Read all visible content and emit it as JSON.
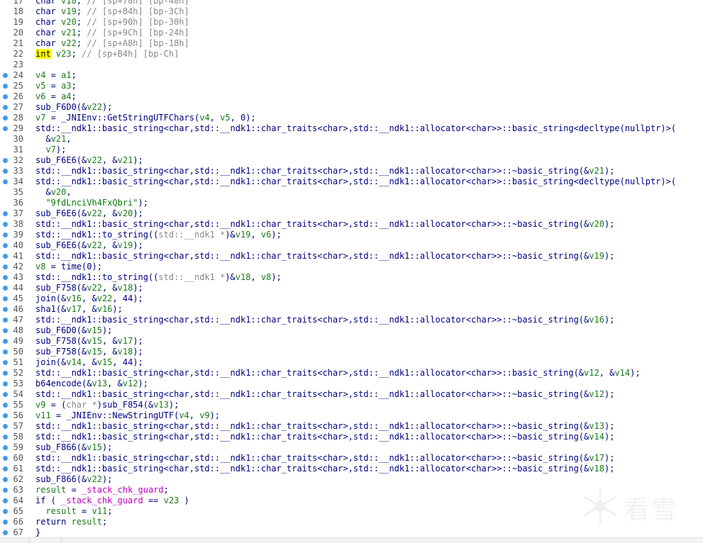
{
  "editor": {
    "lines": [
      {
        "n": "17",
        "bp": false,
        "parts": [
          [
            "t",
            "char "
          ],
          [
            "v",
            "v18"
          ],
          [
            "t",
            "; "
          ],
          [
            "g",
            "// [sp+78h] [bp-48h]"
          ]
        ]
      },
      {
        "n": "18",
        "bp": false,
        "parts": [
          [
            "t",
            "char "
          ],
          [
            "v",
            "v19"
          ],
          [
            "t",
            "; "
          ],
          [
            "g",
            "// [sp+84h] [bp-3Ch]"
          ]
        ]
      },
      {
        "n": "19",
        "bp": false,
        "parts": [
          [
            "t",
            "char "
          ],
          [
            "v",
            "v20"
          ],
          [
            "t",
            "; "
          ],
          [
            "g",
            "// [sp+90h] [bp-30h]"
          ]
        ]
      },
      {
        "n": "20",
        "bp": false,
        "parts": [
          [
            "t",
            "char "
          ],
          [
            "v",
            "v21"
          ],
          [
            "t",
            "; "
          ],
          [
            "g",
            "// [sp+9Ch] [bp-24h]"
          ]
        ]
      },
      {
        "n": "21",
        "bp": false,
        "parts": [
          [
            "t",
            "char "
          ],
          [
            "v",
            "v22"
          ],
          [
            "t",
            "; "
          ],
          [
            "g",
            "// [sp+A8h] [bp-18h]"
          ]
        ]
      },
      {
        "n": "22",
        "bp": false,
        "parts": [
          [
            "h",
            "int"
          ],
          [
            "t",
            " "
          ],
          [
            "v",
            "v23"
          ],
          [
            "t",
            "; "
          ],
          [
            "g",
            "// [sp+B4h] [bp-Ch]"
          ]
        ]
      },
      {
        "n": "23",
        "bp": false,
        "parts": []
      },
      {
        "n": "24",
        "bp": true,
        "parts": [
          [
            "v",
            "v4"
          ],
          [
            "t",
            " = "
          ],
          [
            "v",
            "a1"
          ],
          [
            "t",
            ";"
          ]
        ]
      },
      {
        "n": "25",
        "bp": true,
        "parts": [
          [
            "v",
            "v5"
          ],
          [
            "t",
            " = "
          ],
          [
            "v",
            "a3"
          ],
          [
            "t",
            ";"
          ]
        ]
      },
      {
        "n": "26",
        "bp": true,
        "parts": [
          [
            "v",
            "v6"
          ],
          [
            "t",
            " = "
          ],
          [
            "v",
            "a4"
          ],
          [
            "t",
            ";"
          ]
        ]
      },
      {
        "n": "27",
        "bp": true,
        "parts": [
          [
            "t",
            "sub_F6D0(&"
          ],
          [
            "v",
            "v22"
          ],
          [
            "t",
            ");"
          ]
        ]
      },
      {
        "n": "28",
        "bp": true,
        "parts": [
          [
            "v",
            "v7"
          ],
          [
            "t",
            " = _JNIEnv::GetStringUTFChars("
          ],
          [
            "v",
            "v4"
          ],
          [
            "t",
            ", "
          ],
          [
            "v",
            "v5"
          ],
          [
            "t",
            ", 0);"
          ]
        ]
      },
      {
        "n": "29",
        "bp": true,
        "parts": [
          [
            "t",
            "std::__ndk1::basic_string<char,std::__ndk1::char_traits<char>,std::__ndk1::allocator<char>>::basic_string<decltype(nullptr)>("
          ]
        ]
      },
      {
        "n": "30",
        "bp": false,
        "parts": [
          [
            "t",
            "  &"
          ],
          [
            "v",
            "v21"
          ],
          [
            "t",
            ","
          ]
        ]
      },
      {
        "n": "31",
        "bp": false,
        "parts": [
          [
            "t",
            "  "
          ],
          [
            "v",
            "v7"
          ],
          [
            "t",
            ");"
          ]
        ]
      },
      {
        "n": "32",
        "bp": true,
        "parts": [
          [
            "t",
            "sub_F6E6(&"
          ],
          [
            "v",
            "v22"
          ],
          [
            "t",
            ", &"
          ],
          [
            "v",
            "v21"
          ],
          [
            "t",
            ");"
          ]
        ]
      },
      {
        "n": "33",
        "bp": true,
        "parts": [
          [
            "t",
            "std::__ndk1::basic_string<char,std::__ndk1::char_traits<char>,std::__ndk1::allocator<char>>::~basic_string(&"
          ],
          [
            "v",
            "v21"
          ],
          [
            "t",
            ");"
          ]
        ]
      },
      {
        "n": "34",
        "bp": true,
        "parts": [
          [
            "t",
            "std::__ndk1::basic_string<char,std::__ndk1::char_traits<char>,std::__ndk1::allocator<char>>::basic_string<decltype(nullptr)>("
          ]
        ]
      },
      {
        "n": "35",
        "bp": false,
        "parts": [
          [
            "t",
            "  &"
          ],
          [
            "v",
            "v20"
          ],
          [
            "t",
            ","
          ]
        ]
      },
      {
        "n": "36",
        "bp": false,
        "parts": [
          [
            "t",
            "  "
          ],
          [
            "s",
            "\"9fdLnciVh4FxQbri\""
          ],
          [
            "t",
            ");"
          ]
        ]
      },
      {
        "n": "37",
        "bp": true,
        "parts": [
          [
            "t",
            "sub_F6E6(&"
          ],
          [
            "v",
            "v22"
          ],
          [
            "t",
            ", &"
          ],
          [
            "v",
            "v20"
          ],
          [
            "t",
            ");"
          ]
        ]
      },
      {
        "n": "38",
        "bp": true,
        "parts": [
          [
            "t",
            "std::__ndk1::basic_string<char,std::__ndk1::char_traits<char>,std::__ndk1::allocator<char>>::~basic_string(&"
          ],
          [
            "v",
            "v20"
          ],
          [
            "t",
            ");"
          ]
        ]
      },
      {
        "n": "39",
        "bp": true,
        "parts": [
          [
            "t",
            "std::__ndk1::to_string(("
          ],
          [
            "g",
            "std::__ndk1 *"
          ],
          [
            "t",
            ")&"
          ],
          [
            "v",
            "v19"
          ],
          [
            "t",
            ", "
          ],
          [
            "v",
            "v6"
          ],
          [
            "t",
            ");"
          ]
        ]
      },
      {
        "n": "40",
        "bp": true,
        "parts": [
          [
            "t",
            "sub_F6E6(&"
          ],
          [
            "v",
            "v22"
          ],
          [
            "t",
            ", &"
          ],
          [
            "v",
            "v19"
          ],
          [
            "t",
            ");"
          ]
        ]
      },
      {
        "n": "41",
        "bp": true,
        "parts": [
          [
            "t",
            "std::__ndk1::basic_string<char,std::__ndk1::char_traits<char>,std::__ndk1::allocator<char>>::~basic_string(&"
          ],
          [
            "v",
            "v19"
          ],
          [
            "t",
            ");"
          ]
        ]
      },
      {
        "n": "42",
        "bp": true,
        "parts": [
          [
            "v",
            "v8"
          ],
          [
            "t",
            " = time(0);"
          ]
        ]
      },
      {
        "n": "43",
        "bp": true,
        "parts": [
          [
            "t",
            "std::__ndk1::to_string(("
          ],
          [
            "g",
            "std::__ndk1 *"
          ],
          [
            "t",
            ")&"
          ],
          [
            "v",
            "v18"
          ],
          [
            "t",
            ", "
          ],
          [
            "v",
            "v8"
          ],
          [
            "t",
            ");"
          ]
        ]
      },
      {
        "n": "44",
        "bp": true,
        "parts": [
          [
            "t",
            "sub_F758(&"
          ],
          [
            "v",
            "v22"
          ],
          [
            "t",
            ", &"
          ],
          [
            "v",
            "v18"
          ],
          [
            "t",
            ");"
          ]
        ]
      },
      {
        "n": "45",
        "bp": true,
        "parts": [
          [
            "t",
            "join(&"
          ],
          [
            "v",
            "v16"
          ],
          [
            "t",
            ", &"
          ],
          [
            "v",
            "v22"
          ],
          [
            "t",
            ", 44);"
          ]
        ]
      },
      {
        "n": "46",
        "bp": true,
        "parts": [
          [
            "t",
            "sha1(&"
          ],
          [
            "v",
            "v17"
          ],
          [
            "t",
            ", &"
          ],
          [
            "v",
            "v16"
          ],
          [
            "t",
            ");"
          ]
        ]
      },
      {
        "n": "47",
        "bp": true,
        "parts": [
          [
            "t",
            "std::__ndk1::basic_string<char,std::__ndk1::char_traits<char>,std::__ndk1::allocator<char>>::~basic_string(&"
          ],
          [
            "v",
            "v16"
          ],
          [
            "t",
            ");"
          ]
        ]
      },
      {
        "n": "48",
        "bp": true,
        "parts": [
          [
            "t",
            "sub_F6D0(&"
          ],
          [
            "v",
            "v15"
          ],
          [
            "t",
            ");"
          ]
        ]
      },
      {
        "n": "49",
        "bp": true,
        "parts": [
          [
            "t",
            "sub_F758(&"
          ],
          [
            "v",
            "v15"
          ],
          [
            "t",
            ", &"
          ],
          [
            "v",
            "v17"
          ],
          [
            "t",
            ");"
          ]
        ]
      },
      {
        "n": "50",
        "bp": true,
        "parts": [
          [
            "t",
            "sub_F758(&"
          ],
          [
            "v",
            "v15"
          ],
          [
            "t",
            ", &"
          ],
          [
            "v",
            "v18"
          ],
          [
            "t",
            ");"
          ]
        ]
      },
      {
        "n": "51",
        "bp": true,
        "parts": [
          [
            "t",
            "join(&"
          ],
          [
            "v",
            "v14"
          ],
          [
            "t",
            ", &"
          ],
          [
            "v",
            "v15"
          ],
          [
            "t",
            ", 44);"
          ]
        ]
      },
      {
        "n": "52",
        "bp": true,
        "parts": [
          [
            "t",
            "std::__ndk1::basic_string<char,std::__ndk1::char_traits<char>,std::__ndk1::allocator<char>>::basic_string(&"
          ],
          [
            "v",
            "v12"
          ],
          [
            "t",
            ", &"
          ],
          [
            "v",
            "v14"
          ],
          [
            "t",
            ");"
          ]
        ]
      },
      {
        "n": "53",
        "bp": true,
        "parts": [
          [
            "t",
            "b64encode(&"
          ],
          [
            "v",
            "v13"
          ],
          [
            "t",
            ", &"
          ],
          [
            "v",
            "v12"
          ],
          [
            "t",
            ");"
          ]
        ]
      },
      {
        "n": "54",
        "bp": true,
        "parts": [
          [
            "t",
            "std::__ndk1::basic_string<char,std::__ndk1::char_traits<char>,std::__ndk1::allocator<char>>::~basic_string(&"
          ],
          [
            "v",
            "v12"
          ],
          [
            "t",
            ");"
          ]
        ]
      },
      {
        "n": "55",
        "bp": true,
        "parts": [
          [
            "v",
            "v9"
          ],
          [
            "t",
            " = ("
          ],
          [
            "g",
            "char *"
          ],
          [
            "t",
            ")sub_F854(&"
          ],
          [
            "v",
            "v13"
          ],
          [
            "t",
            ");"
          ]
        ]
      },
      {
        "n": "56",
        "bp": true,
        "parts": [
          [
            "v",
            "v11"
          ],
          [
            "t",
            " = _JNIEnv::NewStringUTF("
          ],
          [
            "v",
            "v4"
          ],
          [
            "t",
            ", "
          ],
          [
            "v",
            "v9"
          ],
          [
            "t",
            ");"
          ]
        ]
      },
      {
        "n": "57",
        "bp": true,
        "parts": [
          [
            "t",
            "std::__ndk1::basic_string<char,std::__ndk1::char_traits<char>,std::__ndk1::allocator<char>>::~basic_string(&"
          ],
          [
            "v",
            "v13"
          ],
          [
            "t",
            ");"
          ]
        ]
      },
      {
        "n": "58",
        "bp": true,
        "parts": [
          [
            "t",
            "std::__ndk1::basic_string<char,std::__ndk1::char_traits<char>,std::__ndk1::allocator<char>>::~basic_string(&"
          ],
          [
            "v",
            "v14"
          ],
          [
            "t",
            ");"
          ]
        ]
      },
      {
        "n": "59",
        "bp": true,
        "parts": [
          [
            "t",
            "sub_F866(&"
          ],
          [
            "v",
            "v15"
          ],
          [
            "t",
            ");"
          ]
        ]
      },
      {
        "n": "60",
        "bp": true,
        "parts": [
          [
            "t",
            "std::__ndk1::basic_string<char,std::__ndk1::char_traits<char>,std::__ndk1::allocator<char>>::~basic_string(&"
          ],
          [
            "v",
            "v17"
          ],
          [
            "t",
            ");"
          ]
        ]
      },
      {
        "n": "61",
        "bp": true,
        "parts": [
          [
            "t",
            "std::__ndk1::basic_string<char,std::__ndk1::char_traits<char>,std::__ndk1::allocator<char>>::~basic_string(&"
          ],
          [
            "v",
            "v18"
          ],
          [
            "t",
            ");"
          ]
        ]
      },
      {
        "n": "62",
        "bp": true,
        "parts": [
          [
            "t",
            "sub_F866(&"
          ],
          [
            "v",
            "v22"
          ],
          [
            "t",
            ");"
          ]
        ]
      },
      {
        "n": "63",
        "bp": true,
        "parts": [
          [
            "v",
            "result"
          ],
          [
            "t",
            " = "
          ],
          [
            "m",
            "_stack_chk_guard"
          ],
          [
            "t",
            ";"
          ]
        ]
      },
      {
        "n": "64",
        "bp": true,
        "parts": [
          [
            "t",
            "if ( "
          ],
          [
            "m",
            "_stack_chk_guard"
          ],
          [
            "t",
            " == "
          ],
          [
            "v",
            "v23"
          ],
          [
            "t",
            " )"
          ]
        ]
      },
      {
        "n": "65",
        "bp": true,
        "parts": [
          [
            "t",
            "  "
          ],
          [
            "v",
            "result"
          ],
          [
            "t",
            " = "
          ],
          [
            "v",
            "v11"
          ],
          [
            "t",
            ";"
          ]
        ]
      },
      {
        "n": "66",
        "bp": true,
        "parts": [
          [
            "t",
            "return "
          ],
          [
            "v",
            "result"
          ],
          [
            "t",
            ";"
          ]
        ]
      },
      {
        "n": "67",
        "bp": true,
        "parts": [
          [
            "t",
            "}"
          ]
        ]
      }
    ]
  },
  "watermark": {
    "text": "看雪",
    "icon": "snowflake-icon"
  }
}
